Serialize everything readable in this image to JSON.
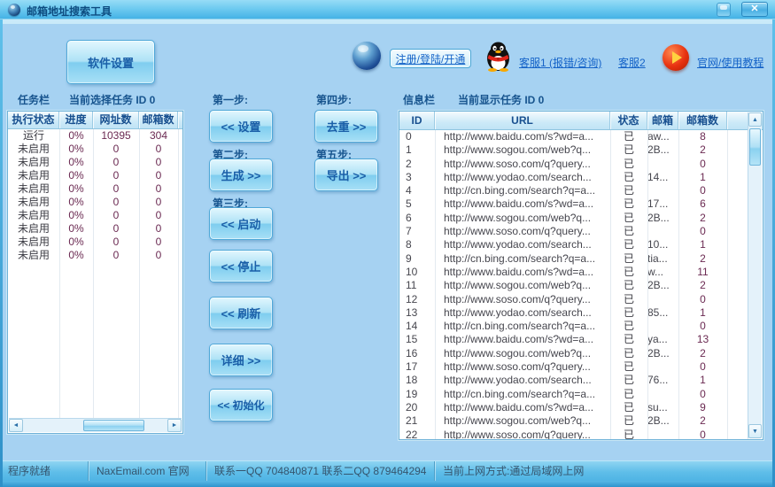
{
  "window": {
    "title": "邮箱地址搜索工具",
    "close_glyph": "✕"
  },
  "toolbar": {
    "settings": "软件设置",
    "register": "注册/登陆/开通",
    "service1": "客服1 (报错/咨询)",
    "service2": "客服2",
    "site": "官网/使用教程"
  },
  "task_panel": {
    "label": "任务栏",
    "current": "当前选择任务 ID 0",
    "columns": [
      "执行状态",
      "进度",
      "网址数",
      "邮箱数"
    ],
    "rows": [
      [
        "运行",
        "0%",
        "10395",
        "304"
      ],
      [
        "未启用",
        "0%",
        "0",
        "0"
      ],
      [
        "未启用",
        "0%",
        "0",
        "0"
      ],
      [
        "未启用",
        "0%",
        "0",
        "0"
      ],
      [
        "未启用",
        "0%",
        "0",
        "0"
      ],
      [
        "未启用",
        "0%",
        "0",
        "0"
      ],
      [
        "未启用",
        "0%",
        "0",
        "0"
      ],
      [
        "未启用",
        "0%",
        "0",
        "0"
      ],
      [
        "未启用",
        "0%",
        "0",
        "0"
      ],
      [
        "未启用",
        "0%",
        "0",
        "0"
      ]
    ]
  },
  "steps": {
    "s1": "第一步:",
    "b1": "<< 设置",
    "s2": "第二步:",
    "b2": "生成 >>",
    "s3": "第三步:",
    "b3": "<< 启动",
    "stop": "<< 停止",
    "refresh": "<< 刷新",
    "detail": "详细 >>",
    "init": "<< 初始化",
    "s4": "第四步:",
    "b4": "去重 >>",
    "s5": "第五步:",
    "b5": "导出 >>"
  },
  "info_panel": {
    "label": "信息栏",
    "current": "当前显示任务 ID 0",
    "columns": [
      "ID",
      "URL",
      "状态",
      "邮箱",
      "邮箱数"
    ],
    "rows": [
      [
        "0",
        "http://www.baidu.com/s?wd=a...",
        "已",
        "aw...",
        "8"
      ],
      [
        "1",
        "http://www.sogou.com/web?q...",
        "已",
        "2B...",
        "2"
      ],
      [
        "2",
        "http://www.soso.com/q?query...",
        "已",
        "",
        "0"
      ],
      [
        "3",
        "http://www.yodao.com/search...",
        "已",
        "14...",
        "1"
      ],
      [
        "4",
        "http://cn.bing.com/search?q=a...",
        "已",
        "",
        "0"
      ],
      [
        "5",
        "http://www.baidu.com/s?wd=a...",
        "已",
        "17...",
        "6"
      ],
      [
        "6",
        "http://www.sogou.com/web?q...",
        "已",
        "2B...",
        "2"
      ],
      [
        "7",
        "http://www.soso.com/q?query...",
        "已",
        "",
        "0"
      ],
      [
        "8",
        "http://www.yodao.com/search...",
        "已",
        "10...",
        "1"
      ],
      [
        "9",
        "http://cn.bing.com/search?q=a...",
        "已",
        "tia...",
        "2"
      ],
      [
        "10",
        "http://www.baidu.com/s?wd=a...",
        "已",
        "w...",
        "11"
      ],
      [
        "11",
        "http://www.sogou.com/web?q...",
        "已",
        "2B...",
        "2"
      ],
      [
        "12",
        "http://www.soso.com/q?query...",
        "已",
        "",
        "0"
      ],
      [
        "13",
        "http://www.yodao.com/search...",
        "已",
        "85...",
        "1"
      ],
      [
        "14",
        "http://cn.bing.com/search?q=a...",
        "已",
        "",
        "0"
      ],
      [
        "15",
        "http://www.baidu.com/s?wd=a...",
        "已",
        "ya...",
        "13"
      ],
      [
        "16",
        "http://www.sogou.com/web?q...",
        "已",
        "2B...",
        "2"
      ],
      [
        "17",
        "http://www.soso.com/q?query...",
        "已",
        "",
        "0"
      ],
      [
        "18",
        "http://www.yodao.com/search...",
        "已",
        "76...",
        "1"
      ],
      [
        "19",
        "http://cn.bing.com/search?q=a...",
        "已",
        "",
        "0"
      ],
      [
        "20",
        "http://www.baidu.com/s?wd=a...",
        "已",
        "su...",
        "9"
      ],
      [
        "21",
        "http://www.sogou.com/web?q...",
        "已",
        "2B...",
        "2"
      ],
      [
        "22",
        "http://www.soso.com/q?query...",
        "已",
        "",
        "0"
      ]
    ]
  },
  "status_bar": {
    "segments": [
      "程序就绪",
      "NaxEmail.com 官网",
      "联系一QQ 704840871 联系二QQ 879464294",
      "当前上网方式:通过局域网上网"
    ]
  },
  "scrollbar": {
    "up": "▲",
    "down": "▼",
    "left": "◄",
    "right": "►"
  },
  "colors": {
    "accent": "#45B2E6",
    "link": "#1563C8",
    "button_text": "#1A5FA8",
    "numbers": "#6B2A52"
  }
}
